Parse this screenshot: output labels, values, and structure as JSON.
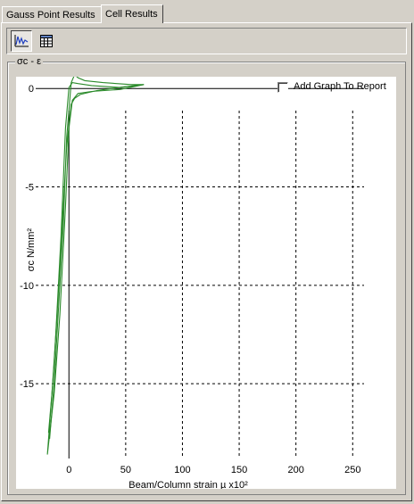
{
  "tabs": [
    {
      "label": "Gauss Point Results",
      "active": false
    },
    {
      "label": "Cell Results",
      "active": true
    }
  ],
  "toolbar": {
    "graph_view_icon": "line-graph-icon",
    "table_view_icon": "table-grid-icon"
  },
  "group_title": "σc - ε",
  "add_graph_label": "Add Graph To Report",
  "add_graph_checked": false,
  "chart_data": {
    "type": "line",
    "title": "σc - ε",
    "xlabel": "Beam/Column strain µ x10²",
    "ylabel": "σc N/mm²",
    "xlim": [
      -23,
      260
    ],
    "ylim": [
      -18.8,
      0.6
    ],
    "x_ticks": [
      0,
      50,
      100,
      150,
      200,
      250
    ],
    "y_ticks": [
      0,
      -5,
      -10,
      -15
    ],
    "grid": true,
    "series": [
      {
        "color": "#2a8a2a",
        "x": [
          -17,
          -13,
          -9,
          -5,
          -2,
          2,
          5,
          8,
          14,
          30,
          55,
          66,
          50,
          25,
          10,
          5,
          2,
          -2,
          -7,
          -11,
          -15,
          -18
        ],
        "y": [
          -17.8,
          -15,
          -11,
          -7,
          -2.5,
          0.3,
          0.7,
          0.55,
          0.4,
          0.3,
          0.2,
          0.2,
          0.1,
          -0.1,
          -0.3,
          -0.5,
          -0.8,
          -3,
          -8,
          -12,
          -15.5,
          -17.5
        ]
      },
      {
        "color": "#2a8a2a",
        "x": [
          -19,
          -13,
          -7,
          -3,
          0,
          3,
          8,
          20,
          45,
          66,
          45,
          20,
          8,
          3,
          0,
          -3,
          -8,
          -13,
          -19
        ],
        "y": [
          -18.6,
          -14,
          -7.5,
          -2,
          0.05,
          0.3,
          0.25,
          0.15,
          0.05,
          0.2,
          -0.05,
          -0.15,
          -0.25,
          -0.6,
          -2,
          -6,
          -11.5,
          -15.5,
          -18.6
        ]
      }
    ]
  }
}
